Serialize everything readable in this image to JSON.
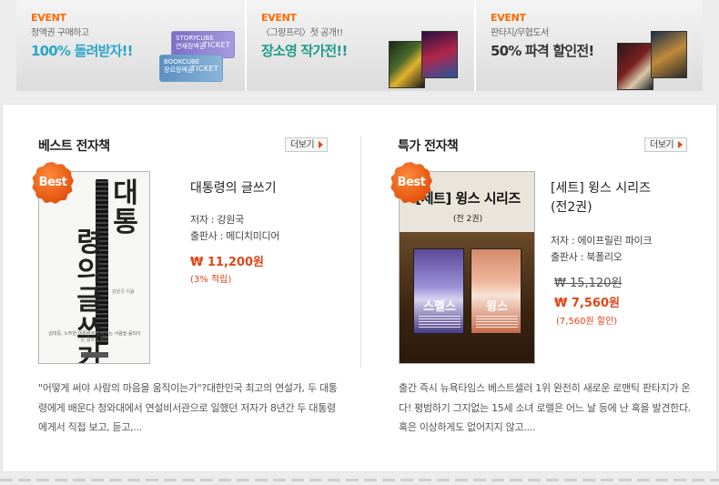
{
  "events": [
    {
      "tag": "EVENT",
      "sub": "정액권 구매하고",
      "main": "100% 돌려받자!!",
      "tickets": [
        {
          "brand": "STORYCUBE",
          "name": "연재정액권",
          "kind": "TICKET"
        },
        {
          "brand": "BOOKCUBE",
          "name": "장르정액권",
          "kind": "TICKET"
        }
      ]
    },
    {
      "tag": "EVENT",
      "sub": "〈그랑프리〉첫 공개!!",
      "main": "장소영 작가전!!"
    },
    {
      "tag": "EVENT",
      "sub": "판타지/무협도서",
      "main": "50% 파격 할인전!"
    }
  ],
  "best": {
    "title": "베스트 전자책",
    "more": "더보기",
    "badge": "Best",
    "cover": {
      "title_top": "대통",
      "title_rest": "령의\n글쓰기",
      "small": "김대중, 노무현 대통령에게 배우는 사람을 움직이는 글쓰기 비법",
      "author": "강원국 지음"
    },
    "book_title": "대통령의 글쓰기",
    "author": "저자 : 강원국",
    "publisher": "출판사 : 메디치미디어",
    "price": "₩ 11,200원",
    "note": "(3% 적립)",
    "desc": "\"어떻게 써야 사람의 마음을 움직이는가\"?대한민국 최고의 연설가, 두 대통령에게 배운다 청와대에서 연설비서관으로 일했던 저자가 8년간 두 대통령에게서 직접 보고, 듣고,..."
  },
  "special": {
    "title": "특가 전자책",
    "more": "더보기",
    "badge": "Best",
    "cover": {
      "title": "[세트] 윙스 시리즈",
      "volumes": "(전 2권)",
      "book1": "스펠스",
      "book2": "윙스"
    },
    "book_title_line1": "[세트] 윙스 시리즈",
    "book_title_line2": "(전2권)",
    "author": "저자 : 에이프릴린 파이크",
    "publisher": "출판사 : 북폴리오",
    "price_old": "₩ 15,120원",
    "price": "₩ 7,560원",
    "note": "(7,560원 할인)",
    "desc": "출간 즉시 뉴욕타임스 베스트셀러 1위 완전히 새로운 로맨틱 판타지가 온다! 평범하기 그지없는 15세 소녀 로렐은 어느 날 등에 난 혹을 발견한다. 혹은 이상하게도 없어지지 않고...."
  },
  "colors": {
    "accent": "#e0461a",
    "event_tag": "#ff6a00",
    "badge": "#e2530f"
  },
  "icons": {
    "more_arrow": "arrow-right-icon"
  }
}
